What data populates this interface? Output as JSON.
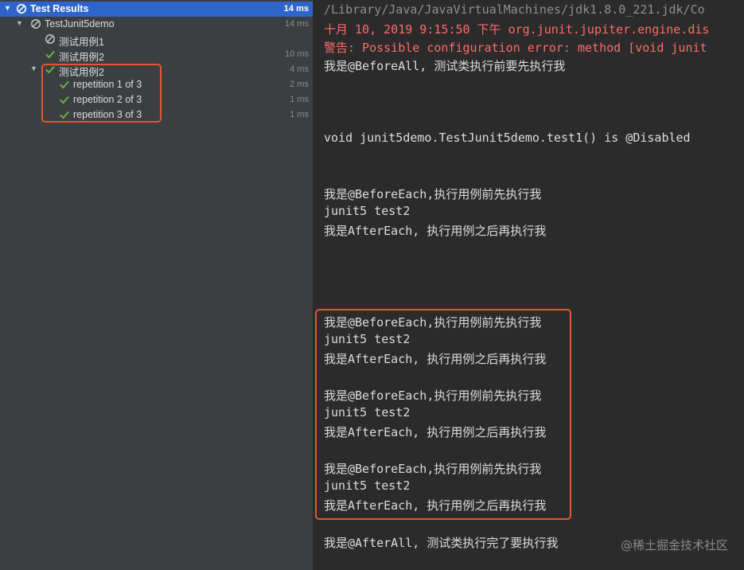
{
  "tree": {
    "rows": [
      {
        "name": "Test Results",
        "time": "14 ms",
        "status": "ignored",
        "expanded": true,
        "selected": true
      },
      {
        "name": "TestJunit5demo",
        "time": "14 ms",
        "status": "ignored",
        "expanded": true
      },
      {
        "name": "测试用例1",
        "time": "",
        "status": "ignored"
      },
      {
        "name": "测试用例2",
        "time": "10 ms",
        "status": "passed"
      },
      {
        "name": "测试用例2",
        "time": "4 ms",
        "status": "passed",
        "expanded": true
      },
      {
        "name": "repetition 1 of 3",
        "time": "2 ms",
        "status": "passed"
      },
      {
        "name": "repetition 2 of 3",
        "time": "1 ms",
        "status": "passed"
      },
      {
        "name": "repetition 3 of 3",
        "time": "1 ms",
        "status": "passed"
      }
    ]
  },
  "console": {
    "lines": [
      "/Library/Java/JavaVirtualMachines/jdk1.8.0_221.jdk/Co",
      "十月 10, 2019 9:15:50 下午 org.junit.jupiter.engine.dis",
      "警告: Possible configuration error: method [void junit",
      "我是@BeforeAll, 测试类执行前要先执行我",
      "void junit5demo.TestJunit5demo.test1() is @Disabled",
      "我是@BeforeEach,执行用例前先执行我",
      "junit5 test2",
      "我是AfterEach, 执行用例之后再执行我",
      "我是@BeforeEach,执行用例前先执行我",
      "junit5 test2",
      "我是AfterEach, 执行用例之后再执行我",
      "我是@BeforeEach,执行用例前先执行我",
      "junit5 test2",
      "我是AfterEach, 执行用例之后再执行我",
      "我是@BeforeEach,执行用例前先执行我",
      "junit5 test2",
      "我是AfterEach, 执行用例之后再执行我",
      "我是@AfterAll, 测试类执行完了要执行我"
    ],
    "watermark": "@稀土掘金技术社区"
  },
  "colors": {
    "selection": "#2f65ca",
    "passed": "#62b543",
    "error": "#ff6b68",
    "highlight": "#e4572e"
  }
}
